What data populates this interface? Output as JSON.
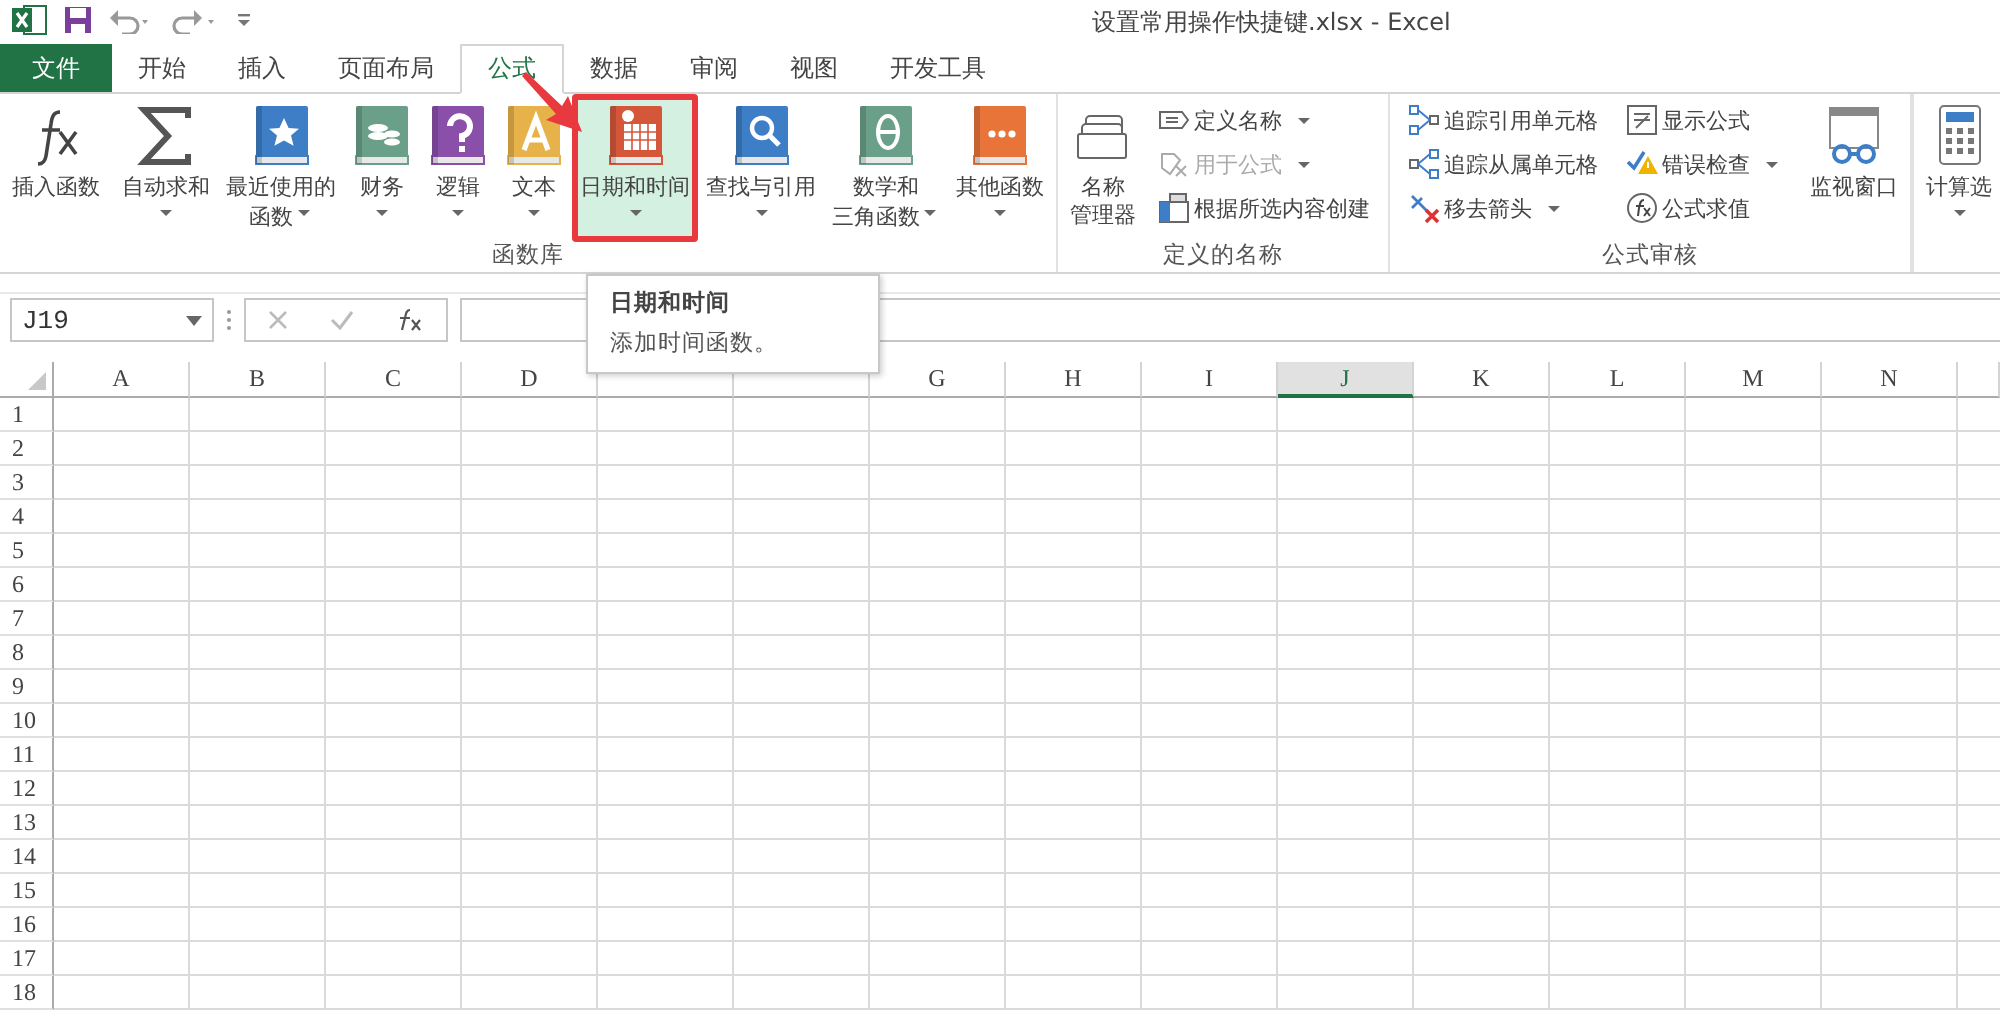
{
  "window": {
    "title": "设置常用操作快捷键.xlsx - Excel"
  },
  "tabs": [
    {
      "label": "文件",
      "kind": "file",
      "selected": false
    },
    {
      "label": "开始",
      "kind": "tab",
      "selected": false
    },
    {
      "label": "插入",
      "kind": "tab",
      "selected": false
    },
    {
      "label": "页面布局",
      "kind": "tab",
      "selected": false
    },
    {
      "label": "公式",
      "kind": "tab",
      "selected": true
    },
    {
      "label": "数据",
      "kind": "tab",
      "selected": false
    },
    {
      "label": "审阅",
      "kind": "tab",
      "selected": false
    },
    {
      "label": "视图",
      "kind": "tab",
      "selected": false
    },
    {
      "label": "开发工具",
      "kind": "tab",
      "selected": false
    }
  ],
  "ribbon": {
    "groups": [
      {
        "label": "函数库",
        "large": [
          {
            "lines": [
              "插入函数"
            ],
            "dropdown": false,
            "highlighted": false
          },
          {
            "lines": [
              "自动求和"
            ],
            "dropdown": true,
            "highlighted": false
          },
          {
            "lines": [
              "最近使用的",
              "函数"
            ],
            "dropdown": true,
            "highlighted": false
          },
          {
            "lines": [
              "财务"
            ],
            "dropdown": true,
            "highlighted": false
          },
          {
            "lines": [
              "逻辑"
            ],
            "dropdown": true,
            "highlighted": false
          },
          {
            "lines": [
              "文本"
            ],
            "dropdown": true,
            "highlighted": false
          },
          {
            "lines": [
              "日期和时间"
            ],
            "dropdown": true,
            "highlighted": true
          },
          {
            "lines": [
              "查找与引用"
            ],
            "dropdown": true,
            "highlighted": false
          },
          {
            "lines": [
              "数学和",
              "三角函数"
            ],
            "dropdown": true,
            "highlighted": false
          },
          {
            "lines": [
              "其他函数"
            ],
            "dropdown": true,
            "highlighted": false
          }
        ]
      },
      {
        "label": "定义的名称",
        "large": [
          {
            "lines": [
              "名称",
              "管理器"
            ],
            "dropdown": false,
            "highlighted": false
          }
        ],
        "small": [
          {
            "label": "定义名称",
            "dropdown": true,
            "disabled": false
          },
          {
            "label": "用于公式",
            "dropdown": true,
            "disabled": true
          },
          {
            "label": "根据所选内容创建",
            "dropdown": false,
            "disabled": false
          }
        ]
      },
      {
        "label": "公式审核",
        "small": [
          {
            "label": "追踪引用单元格",
            "dropdown": false,
            "disabled": false
          },
          {
            "label": "追踪从属单元格",
            "dropdown": false,
            "disabled": false
          },
          {
            "label": "移去箭头",
            "dropdown": true,
            "disabled": false
          },
          {
            "label": "显示公式",
            "dropdown": false,
            "disabled": false
          },
          {
            "label": "错误检查",
            "dropdown": true,
            "disabled": false
          },
          {
            "label": "公式求值",
            "dropdown": false,
            "disabled": false
          }
        ],
        "large": [
          {
            "lines": [
              "监视窗口"
            ],
            "dropdown": false,
            "highlighted": false
          }
        ]
      },
      {
        "large": [
          {
            "lines": [
              "计算选"
            ],
            "dropdown": true,
            "highlighted": false
          }
        ]
      }
    ]
  },
  "tooltip": {
    "title": "日期和时间",
    "description": "添加时间函数。"
  },
  "formula_bar": {
    "name_box": "J19"
  },
  "sheet": {
    "columns": [
      {
        "label": "A",
        "selected": false
      },
      {
        "label": "B",
        "selected": false
      },
      {
        "label": "C",
        "selected": false
      },
      {
        "label": "D",
        "selected": false
      },
      {
        "selected": false
      },
      {
        "selected": false
      },
      {
        "label": "G",
        "selected": false
      },
      {
        "label": "H",
        "selected": false
      },
      {
        "label": "I",
        "selected": false
      },
      {
        "label": "J",
        "selected": true
      },
      {
        "label": "K",
        "selected": false
      },
      {
        "label": "L",
        "selected": false
      },
      {
        "label": "M",
        "selected": false
      },
      {
        "label": "N",
        "selected": false
      }
    ],
    "rows": [
      "1",
      "2",
      "3",
      "4",
      "5",
      "6",
      "7",
      "8",
      "9",
      "10",
      "11",
      "12",
      "13",
      "14",
      "15",
      "16",
      "17",
      "18"
    ]
  }
}
